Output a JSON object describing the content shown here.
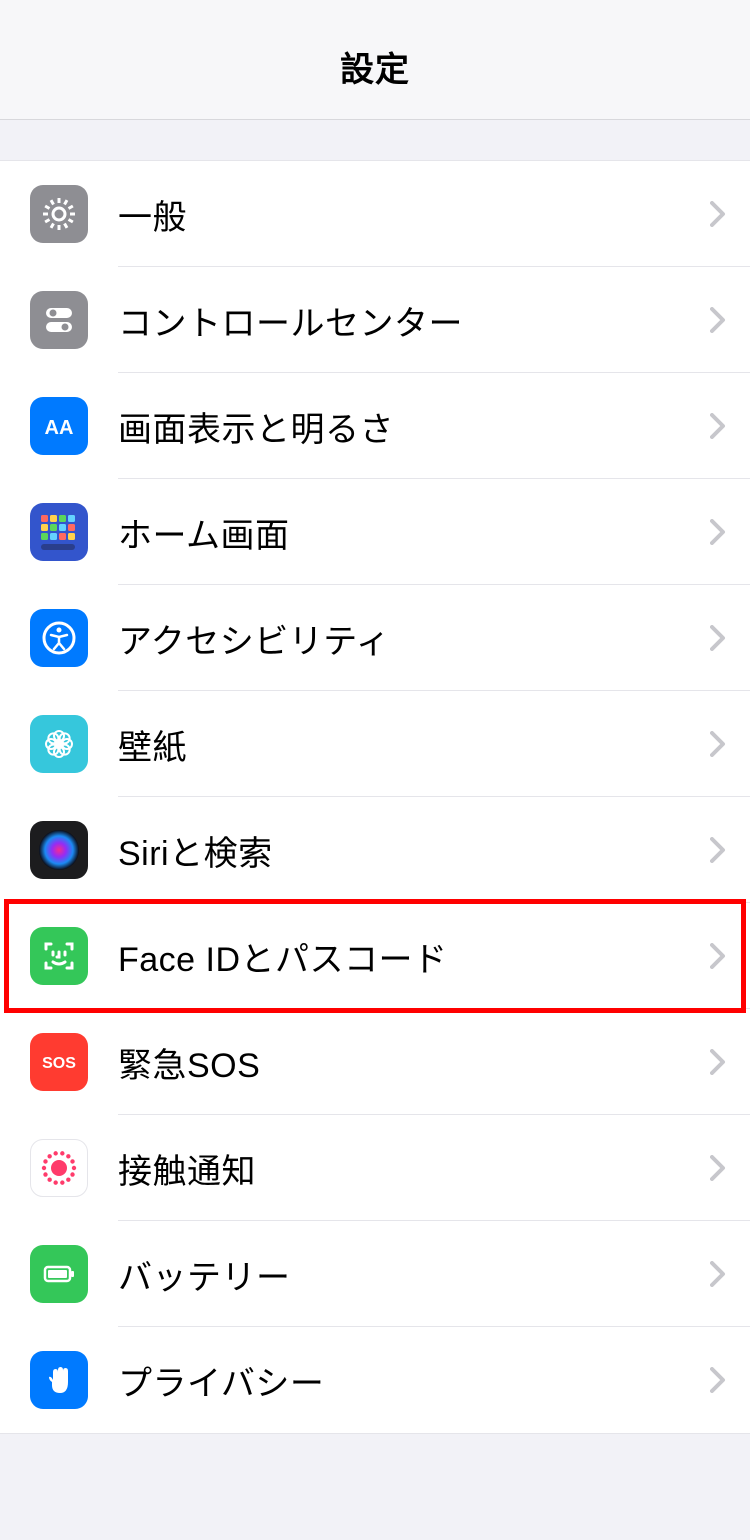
{
  "header": {
    "title": "設定"
  },
  "settings_items": [
    {
      "id": "general",
      "label": "一般",
      "icon": "gear",
      "bg": "#8e8e93"
    },
    {
      "id": "control",
      "label": "コントロールセンター",
      "icon": "switches",
      "bg": "#8e8e93"
    },
    {
      "id": "display",
      "label": "画面表示と明るさ",
      "icon": "aa",
      "bg": "#007aff"
    },
    {
      "id": "home",
      "label": "ホーム画面",
      "icon": "apps",
      "bg": "#3355cc"
    },
    {
      "id": "accessibility",
      "label": "アクセシビリティ",
      "icon": "access",
      "bg": "#007aff"
    },
    {
      "id": "wallpaper",
      "label": "壁紙",
      "icon": "flower",
      "bg": "#36c7dc"
    },
    {
      "id": "siri",
      "label": "Siriと検索",
      "icon": "siri",
      "bg": "#1c1c1e"
    },
    {
      "id": "faceid",
      "label": "Face IDとパスコード",
      "icon": "faceid",
      "bg": "#34c759",
      "highlighted": true
    },
    {
      "id": "sos",
      "label": "緊急SOS",
      "icon": "sos",
      "bg": "#ff3b30"
    },
    {
      "id": "exposure",
      "label": "接触通知",
      "icon": "exposure",
      "bg": "#ffffff"
    },
    {
      "id": "battery",
      "label": "バッテリー",
      "icon": "battery",
      "bg": "#34c759"
    },
    {
      "id": "privacy",
      "label": "プライバシー",
      "icon": "hand",
      "bg": "#007aff"
    }
  ]
}
